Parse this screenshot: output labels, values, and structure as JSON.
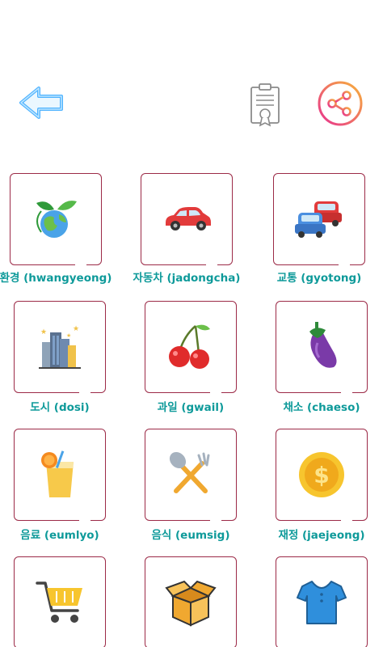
{
  "header": {
    "back_icon": "arrow-left-icon",
    "certificate_icon": "certificate-icon",
    "share_icon": "share-icon"
  },
  "colors": {
    "card_border": "#9c2a47",
    "label_text": "#0e9a9a",
    "back_arrow": "#4fb3ff"
  },
  "categories": [
    {
      "label": "환경 (hwangyeong)",
      "icon": "earth-leaves-icon"
    },
    {
      "label": "자동차 (jadongcha)",
      "icon": "car-icon"
    },
    {
      "label": "교통 (gyotong)",
      "icon": "traffic-cars-icon"
    },
    {
      "label": "도시 (dosi)",
      "icon": "city-buildings-icon"
    },
    {
      "label": "과일 (gwail)",
      "icon": "cherries-icon"
    },
    {
      "label": "채소 (chaeso)",
      "icon": "eggplant-icon"
    },
    {
      "label": "음료 (eumlyo)",
      "icon": "drink-juice-icon"
    },
    {
      "label": "음식 (eumsig)",
      "icon": "spoon-fork-icon"
    },
    {
      "label": "재정 (jaejeong)",
      "icon": "dollar-coin-icon"
    },
    {
      "label": "",
      "icon": "shopping-cart-icon"
    },
    {
      "label": "",
      "icon": "box-icon"
    },
    {
      "label": "",
      "icon": "shirt-icon"
    }
  ]
}
